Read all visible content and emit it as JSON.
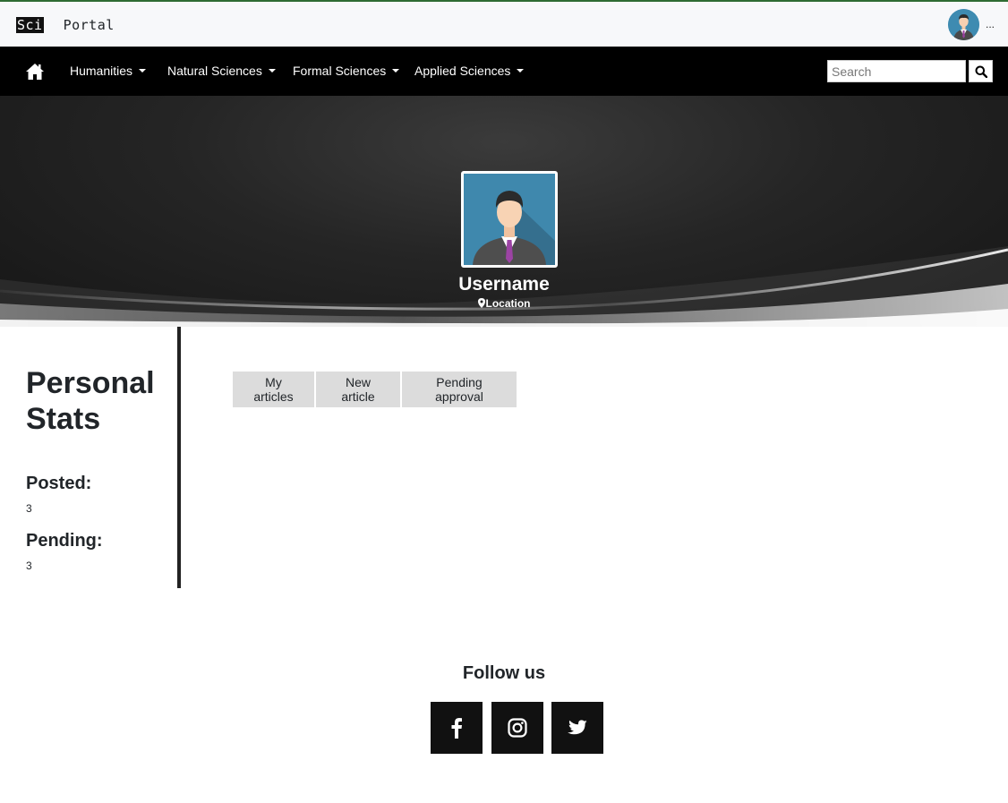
{
  "header": {
    "logo_part1": "Sci",
    "logo_part2": "Portal",
    "user_menu_label": "..."
  },
  "nav": {
    "items": [
      {
        "label": "Humanities"
      },
      {
        "label": "Natural Sciences"
      },
      {
        "label": "Formal Sciences"
      },
      {
        "label": "Applied Sciences"
      }
    ],
    "search_placeholder": "Search"
  },
  "profile": {
    "username": "Username",
    "location": "Location"
  },
  "stats": {
    "title_line1": "Personal",
    "title_line2": "Stats",
    "posted_label": "Posted:",
    "posted_value": "3",
    "pending_label": "Pending:",
    "pending_value": "3"
  },
  "tabs": [
    {
      "label": "My articles"
    },
    {
      "label": "New article"
    },
    {
      "label": "Pending approval"
    }
  ],
  "footer": {
    "follow_title": "Follow us",
    "social": [
      {
        "icon": "facebook-icon"
      },
      {
        "icon": "instagram-icon"
      },
      {
        "icon": "twitter-icon"
      }
    ]
  },
  "colors": {
    "topbar_border": "#2e6b33",
    "nav_bg": "#000000",
    "tab_bg": "#dcdcdc",
    "social_bg": "#111111"
  }
}
